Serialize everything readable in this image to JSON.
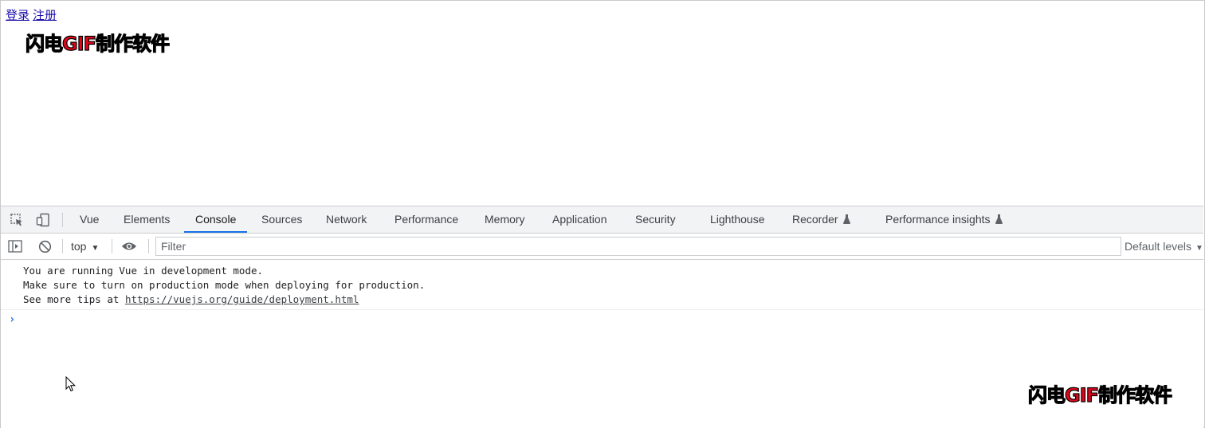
{
  "page": {
    "links": [
      {
        "label": "登录"
      },
      {
        "label": "注册"
      }
    ],
    "watermark": {
      "red": "闪电GIF",
      "white": "制作软件"
    }
  },
  "devtools": {
    "tabs": [
      {
        "label": "Vue"
      },
      {
        "label": "Elements"
      },
      {
        "label": "Console"
      },
      {
        "label": "Sources"
      },
      {
        "label": "Network"
      },
      {
        "label": "Performance"
      },
      {
        "label": "Memory"
      },
      {
        "label": "Application"
      },
      {
        "label": "Security"
      },
      {
        "label": "Lighthouse"
      },
      {
        "label": "Recorder"
      },
      {
        "label": "Performance insights"
      }
    ],
    "active_tab": "Console",
    "toolbar": {
      "context": "top",
      "filter_placeholder": "Filter",
      "levels": "Default levels"
    },
    "console": {
      "messages": [
        {
          "text": "You are running Vue in development mode."
        },
        {
          "text": "Make sure to turn on production mode when deploying for production."
        },
        {
          "prefix": "See more tips at ",
          "link": "https://vuejs.org/guide/deployment.html"
        }
      ],
      "prompt": "›"
    }
  },
  "colors": {
    "accent": "#1a73e8",
    "link": "#1a0dab",
    "watermark_red": "#e1061a"
  }
}
